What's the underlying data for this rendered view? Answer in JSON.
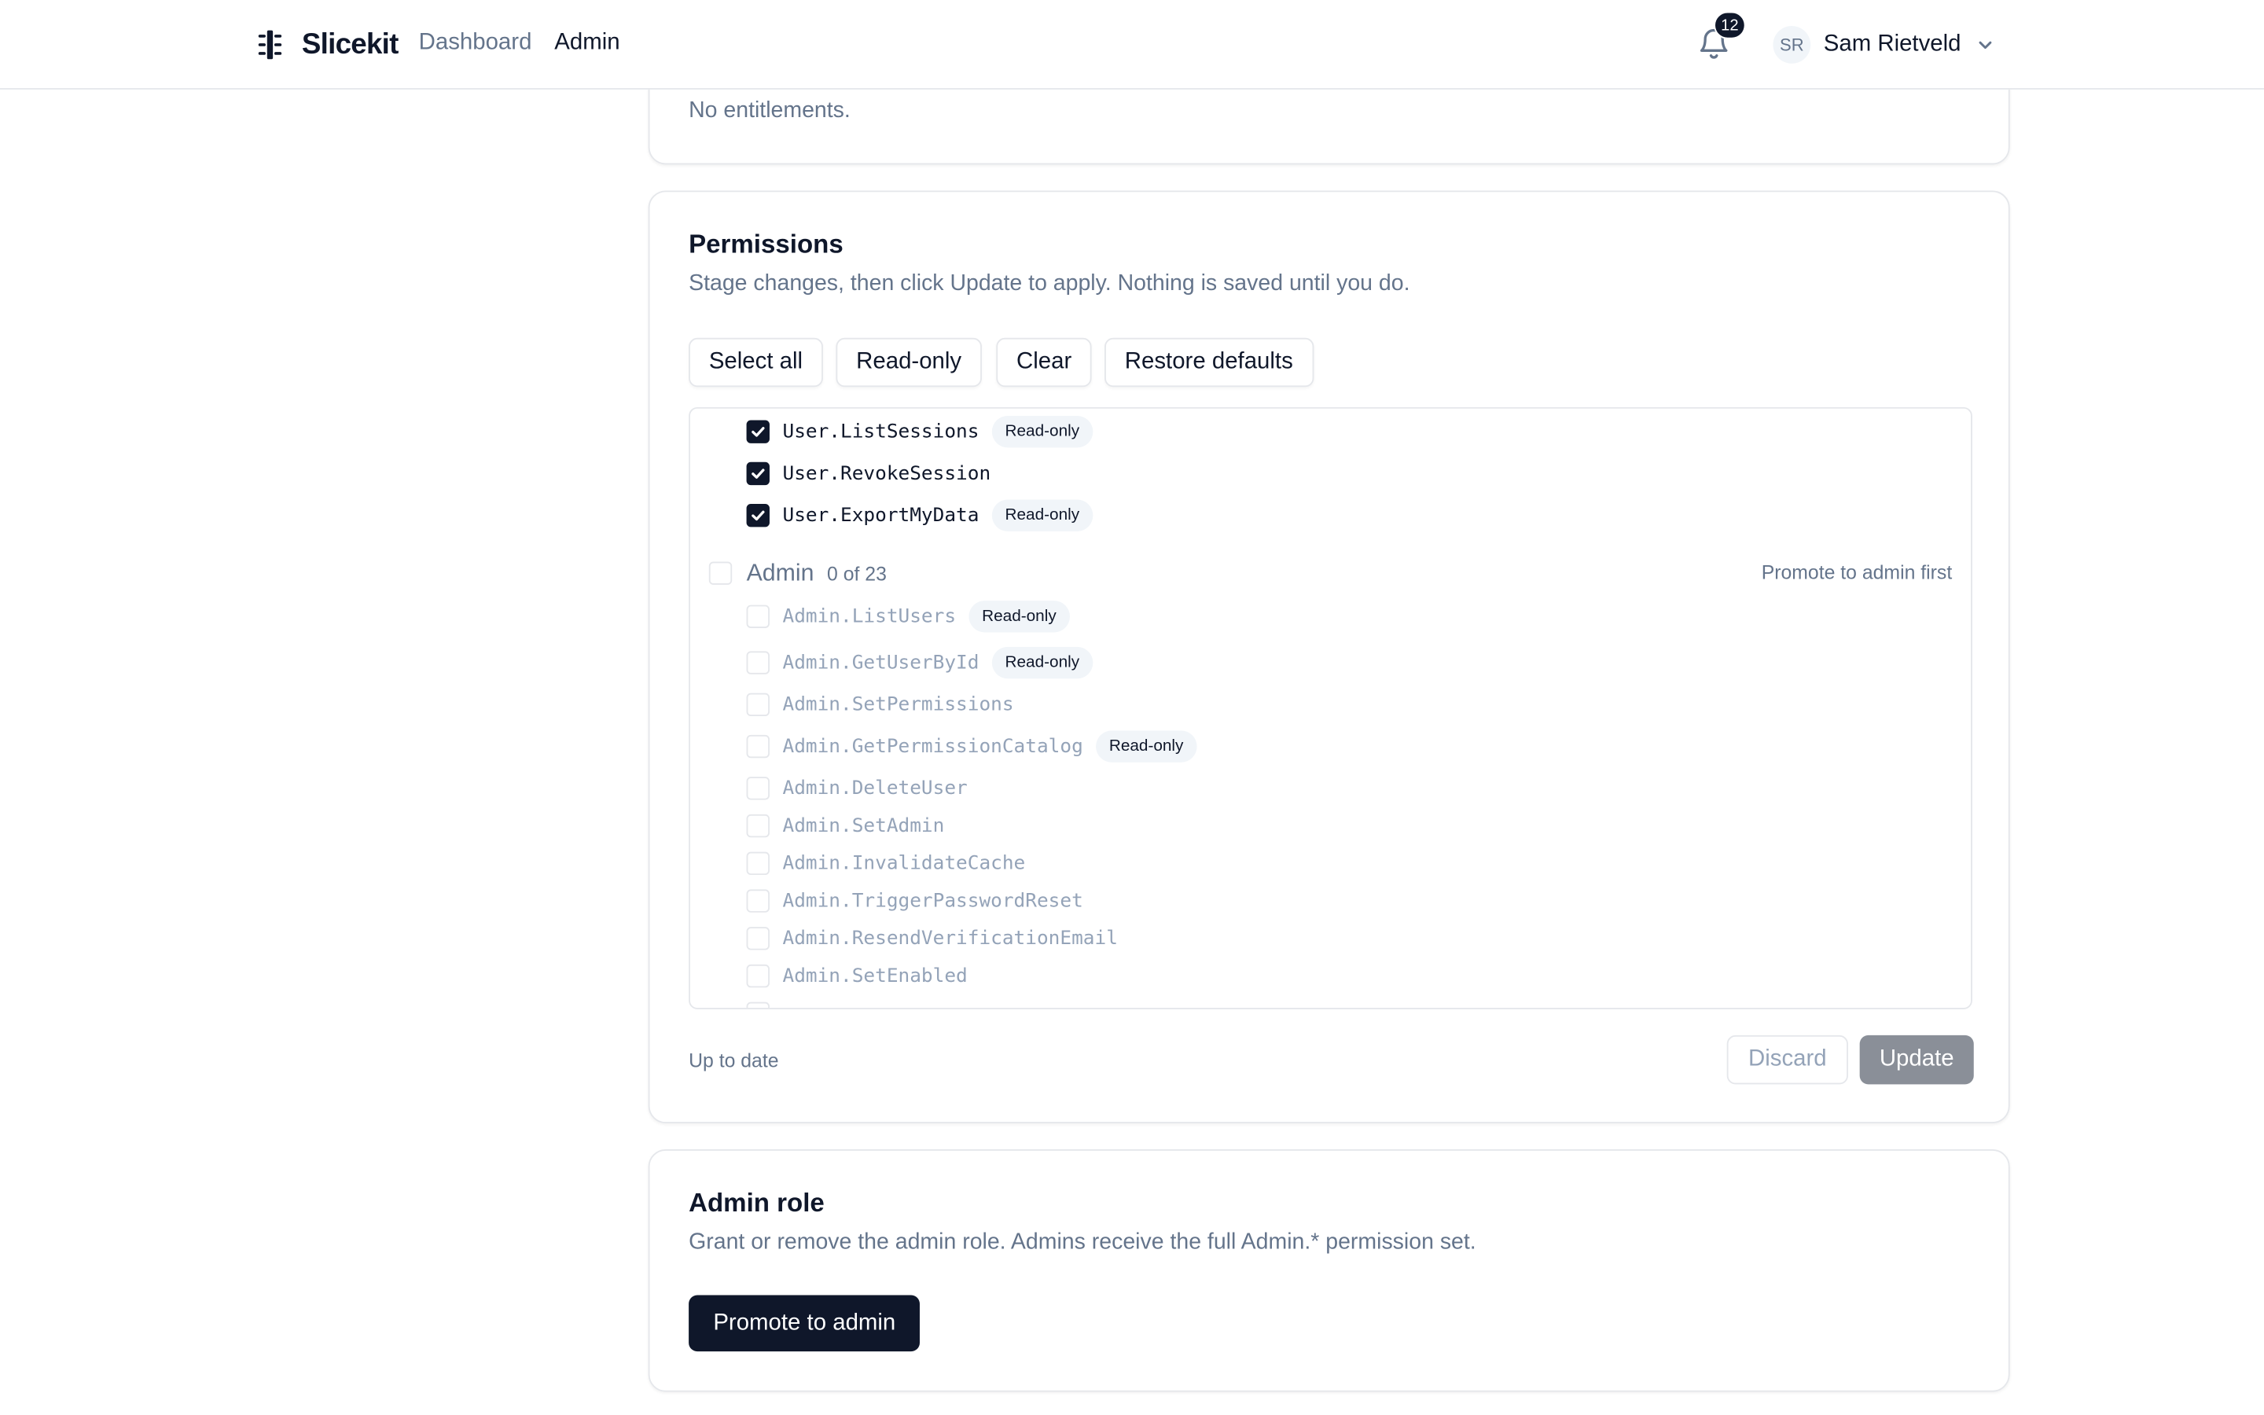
{
  "header": {
    "brand": "Slicekit",
    "nav": [
      "Dashboard",
      "Admin"
    ],
    "active_nav": "Admin",
    "notifications_count": "12",
    "user": {
      "initials": "SR",
      "name": "Sam Rietveld"
    }
  },
  "entitlements": {
    "empty_text": "No entitlements."
  },
  "permissions": {
    "title": "Permissions",
    "description": "Stage changes, then click Update to apply. Nothing is saved until you do.",
    "actions": {
      "select_all": "Select all",
      "read_only": "Read-only",
      "clear": "Clear",
      "restore_defaults": "Restore defaults"
    },
    "user_items": [
      {
        "name": "User.ListSessions",
        "checked": true,
        "badge": "Read-only"
      },
      {
        "name": "User.RevokeSession",
        "checked": true,
        "badge": ""
      },
      {
        "name": "User.ExportMyData",
        "checked": true,
        "badge": "Read-only"
      }
    ],
    "admin_group": {
      "label": "Admin",
      "count": "0 of 23",
      "note": "Promote to admin first"
    },
    "admin_items": [
      {
        "name": "Admin.ListUsers",
        "checked": false,
        "badge": "Read-only"
      },
      {
        "name": "Admin.GetUserById",
        "checked": false,
        "badge": "Read-only"
      },
      {
        "name": "Admin.SetPermissions",
        "checked": false,
        "badge": ""
      },
      {
        "name": "Admin.GetPermissionCatalog",
        "checked": false,
        "badge": "Read-only"
      },
      {
        "name": "Admin.DeleteUser",
        "checked": false,
        "badge": ""
      },
      {
        "name": "Admin.SetAdmin",
        "checked": false,
        "badge": ""
      },
      {
        "name": "Admin.InvalidateCache",
        "checked": false,
        "badge": ""
      },
      {
        "name": "Admin.TriggerPasswordReset",
        "checked": false,
        "badge": ""
      },
      {
        "name": "Admin.ResendVerificationEmail",
        "checked": false,
        "badge": ""
      },
      {
        "name": "Admin.SetEnabled",
        "checked": false,
        "badge": ""
      }
    ],
    "status": "Up to date",
    "discard_label": "Discard",
    "update_label": "Update"
  },
  "admin_role": {
    "title": "Admin role",
    "description": "Grant or remove the admin role. Admins receive the full Admin.* permission set.",
    "button": "Promote to admin"
  },
  "colors": {
    "primary": "#0f172a",
    "muted": "#64748b",
    "border": "#e5e7eb",
    "badge_bg": "#f1f5f9",
    "disabled_button": "#8a8f98"
  },
  "icons": {
    "logo": "slicekit-logo-icon",
    "notifications": "bell-icon",
    "user_menu": "chevron-down-icon",
    "checkbox": "check-icon"
  }
}
